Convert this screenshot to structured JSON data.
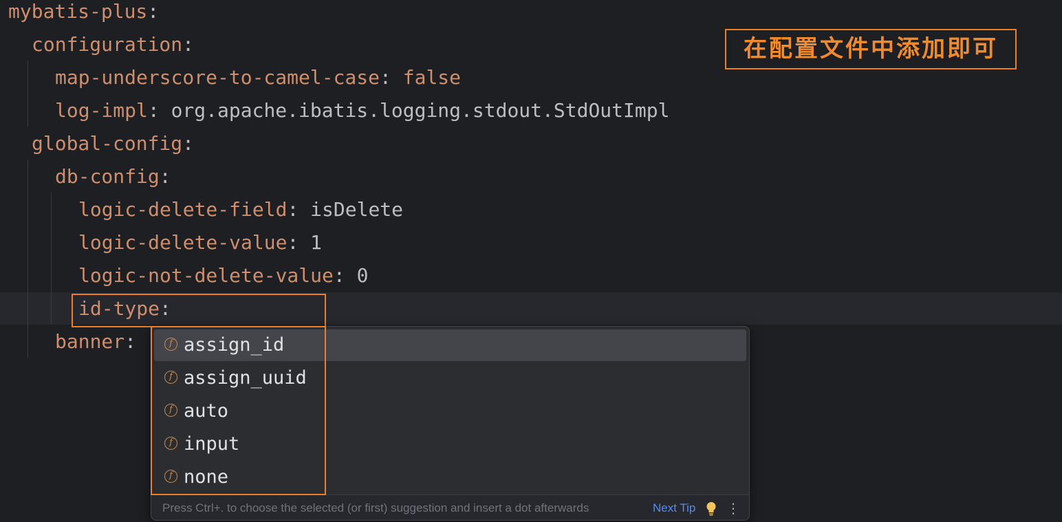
{
  "editor": {
    "lines": [
      {
        "key": "mybatis-plus",
        "sep": ":",
        "value": ""
      },
      {
        "key": "configuration",
        "sep": ":",
        "value": ""
      },
      {
        "key": "map-underscore-to-camel-case",
        "sep": ": ",
        "value": "false"
      },
      {
        "key": "log-impl",
        "sep": ": ",
        "value": "org.apache.ibatis.logging.stdout.StdOutImpl"
      },
      {
        "key": "global-config",
        "sep": ":",
        "value": ""
      },
      {
        "key": "db-config",
        "sep": ":",
        "value": ""
      },
      {
        "key": "logic-delete-field",
        "sep": ": ",
        "value": "isDelete"
      },
      {
        "key": "logic-delete-value",
        "sep": ": ",
        "value": "1"
      },
      {
        "key": "logic-not-delete-value",
        "sep": ": ",
        "value": "0"
      },
      {
        "key": "id-type",
        "sep": ":",
        "value": ""
      },
      {
        "key": "banner",
        "sep": ": ",
        "value": ""
      }
    ]
  },
  "annotation": {
    "label": "在配置文件中添加即可"
  },
  "completion": {
    "icon_letter": "f",
    "items": [
      {
        "label": "assign_id",
        "selected": true
      },
      {
        "label": "assign_uuid",
        "selected": false
      },
      {
        "label": "auto",
        "selected": false
      },
      {
        "label": "input",
        "selected": false
      },
      {
        "label": "none",
        "selected": false
      }
    ],
    "hint": "Press Ctrl+. to choose the selected (or first) suggestion and insert a dot afterwards",
    "next_tip": "Next Tip",
    "more_icon": "⋮"
  },
  "colors": {
    "background": "#1e1f22",
    "key": "#cf8e6d",
    "text": "#bcbec4",
    "annotation": "#e9802e",
    "link": "#548af7"
  }
}
